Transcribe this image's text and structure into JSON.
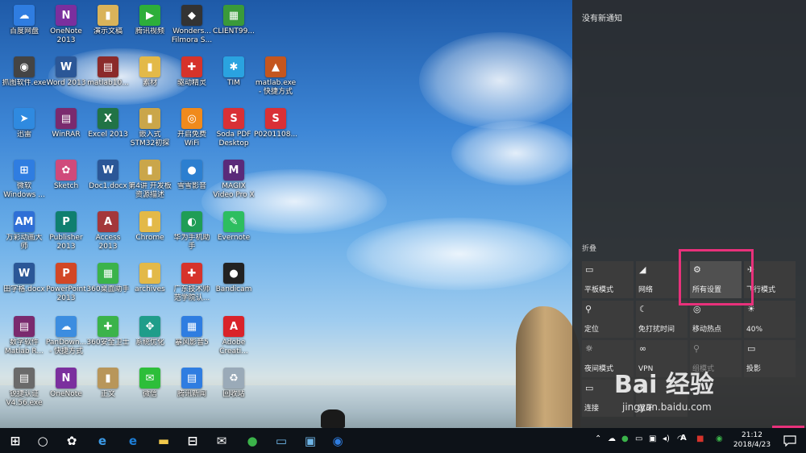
{
  "desktop": {
    "icons": [
      {
        "label": "百度网盘",
        "glyph": "☁",
        "color": "#2f7de1"
      },
      {
        "label": "OneNote\n2013",
        "glyph": "N",
        "color": "#7b2f9e"
      },
      {
        "label": "演示文稿",
        "glyph": "▮",
        "color": "#d9b35a"
      },
      {
        "label": "腾讯视频",
        "glyph": "▶",
        "color": "#2dae3a"
      },
      {
        "label": "Wonders...\nFilmora S...",
        "glyph": "◆",
        "color": "#333333"
      },
      {
        "label": "CLIENT99...",
        "glyph": "▦",
        "color": "#3a9a3a"
      },
      {
        "label": "抓图软件.exe",
        "glyph": "◉",
        "color": "#444444"
      },
      {
        "label": "Word 2013",
        "glyph": "W",
        "color": "#2b5797"
      },
      {
        "label": "matlab10...",
        "glyph": "▤",
        "color": "#8b2a2a"
      },
      {
        "label": "素材",
        "glyph": "▮",
        "color": "#e3b948"
      },
      {
        "label": "驱动精灵",
        "glyph": "✚",
        "color": "#d6332b"
      },
      {
        "label": "TIM",
        "glyph": "✱",
        "color": "#2aa3e0"
      },
      {
        "label": "matlab.exe\n- 快捷方式",
        "glyph": "▲",
        "color": "#c4561f"
      },
      {
        "label": "迅雷",
        "glyph": "➤",
        "color": "#2f8ae0"
      },
      {
        "label": "WinRAR",
        "glyph": "▤",
        "color": "#7a2a6e"
      },
      {
        "label": "Excel 2013",
        "glyph": "X",
        "color": "#217346"
      },
      {
        "label": "嵌入式\nSTM32初探",
        "glyph": "▮",
        "color": "#caa64a"
      },
      {
        "label": "开启免费\nWiFi",
        "glyph": "◎",
        "color": "#f08a1c"
      },
      {
        "label": "Soda PDF\nDesktop",
        "glyph": "S",
        "color": "#d93036"
      },
      {
        "label": "P0201108...",
        "glyph": "S",
        "color": "#d93036"
      },
      {
        "label": "微软\nWindows ...",
        "glyph": "⊞",
        "color": "#2f7de1"
      },
      {
        "label": "Sketch",
        "glyph": "✿",
        "color": "#d04a7b"
      },
      {
        "label": "Doc1.docx",
        "glyph": "W",
        "color": "#2b5797"
      },
      {
        "label": "第4讲 开发板\n资源描述",
        "glyph": "▮",
        "color": "#caa64a"
      },
      {
        "label": "雪雪影音",
        "glyph": "●",
        "color": "#2c7fd0"
      },
      {
        "label": "MAGIX\nVideo Pro X",
        "glyph": "M",
        "color": "#5a2a7a"
      },
      {
        "label": "万彩动画大\n师",
        "glyph": "AM",
        "color": "#2f6fd6"
      },
      {
        "label": "Publisher\n2013",
        "glyph": "P",
        "color": "#0f7f6f"
      },
      {
        "label": "Access 2013",
        "glyph": "A",
        "color": "#a4373a"
      },
      {
        "label": "Chrome",
        "glyph": "▮",
        "color": "#e3b948"
      },
      {
        "label": "华为手机助\n手",
        "glyph": "◐",
        "color": "#1f9d55"
      },
      {
        "label": "Evernote",
        "glyph": "✎",
        "color": "#2dbe60"
      },
      {
        "label": "田字格.docx",
        "glyph": "W",
        "color": "#2b5797"
      },
      {
        "label": "PowerPoint\n2013",
        "glyph": "P",
        "color": "#d24726"
      },
      {
        "label": "360桌面助手",
        "glyph": "▦",
        "color": "#3bb34a"
      },
      {
        "label": "archives",
        "glyph": "▮",
        "color": "#e3b948"
      },
      {
        "label": "广东技术师\n范学院认...",
        "glyph": "✚",
        "color": "#d6332b"
      },
      {
        "label": "Bandicam",
        "glyph": "●",
        "color": "#222222"
      },
      {
        "label": "数字软件\nMatlab R...",
        "glyph": "▤",
        "color": "#7a2a6e"
      },
      {
        "label": "PanDown...\n- 快捷方式",
        "glyph": "☁",
        "color": "#3c8de0"
      },
      {
        "label": "360安全卫士",
        "glyph": "✚",
        "color": "#3bb34a"
      },
      {
        "label": "系统优化",
        "glyph": "✥",
        "color": "#1f9d8a"
      },
      {
        "label": "暴风影音5",
        "glyph": "▦",
        "color": "#2f7de1"
      },
      {
        "label": "Adobe\nCreati...",
        "glyph": "A",
        "color": "#d9232a"
      },
      {
        "label": "锐捷认证\nV4.56.exe",
        "glyph": "▤",
        "color": "#6a6a6a"
      },
      {
        "label": "OneNote",
        "glyph": "N",
        "color": "#7b2f9e"
      },
      {
        "label": "正文",
        "glyph": "▮",
        "color": "#b8965a"
      },
      {
        "label": "微信",
        "glyph": "✉",
        "color": "#2dbe3a"
      },
      {
        "label": "腾讯新闻",
        "glyph": "▤",
        "color": "#2f7de1"
      },
      {
        "label": "回收站",
        "glyph": "♻",
        "color": "#9aaab8"
      }
    ]
  },
  "action_center": {
    "no_notifications": "没有新通知",
    "collapse_label": "折叠",
    "tiles": [
      {
        "label": "平板模式",
        "icon": "▭",
        "state": "off"
      },
      {
        "label": "网络",
        "icon": "◢",
        "state": "off"
      },
      {
        "label": "所有设置",
        "icon": "⚙",
        "state": "on"
      },
      {
        "label": "飞行模式",
        "icon": "✈",
        "state": "off"
      },
      {
        "label": "定位",
        "icon": "⚲",
        "state": "off"
      },
      {
        "label": "免打扰时间",
        "icon": "☾",
        "state": "off"
      },
      {
        "label": "移动热点",
        "icon": "◎",
        "state": "off"
      },
      {
        "label": "40%",
        "icon": "☀",
        "state": "off"
      },
      {
        "label": "夜间模式",
        "icon": "☼",
        "state": "off"
      },
      {
        "label": "VPN",
        "icon": "∞",
        "state": "off"
      },
      {
        "label": "组模式",
        "icon": "⚲",
        "state": "dim"
      },
      {
        "label": "投影",
        "icon": "▭",
        "state": "off"
      },
      {
        "label": "连接",
        "icon": "▭",
        "state": "off"
      },
      {
        "label": "蓝牙",
        "icon": "ᛒ",
        "state": "off"
      }
    ]
  },
  "watermark": {
    "main": "Bai 经验",
    "url": "jingyan.baidu.com"
  },
  "taskbar": {
    "buttons": [
      {
        "name": "start-button",
        "icon": "windows-icon",
        "color": "#ffffff"
      },
      {
        "name": "cortana-button",
        "icon": "circle-icon",
        "color": "#ffffff"
      },
      {
        "name": "taskbar-app-1",
        "icon": "flower-icon",
        "color": "#ffffff"
      },
      {
        "name": "taskbar-ie",
        "icon": "ie-icon",
        "color": "#3c9be8"
      },
      {
        "name": "taskbar-edge",
        "icon": "edge-icon",
        "color": "#1d7fd8"
      },
      {
        "name": "taskbar-explorer",
        "icon": "folder-icon",
        "color": "#f2c94c"
      },
      {
        "name": "taskbar-store",
        "icon": "store-icon",
        "color": "#ffffff"
      },
      {
        "name": "taskbar-mail",
        "icon": "mail-icon",
        "color": "#ffffff"
      },
      {
        "name": "taskbar-app-green",
        "icon": "green-circle-icon",
        "color": "#3bb34a"
      },
      {
        "name": "taskbar-app-pc",
        "icon": "pc-icon",
        "color": "#6fb6e8"
      },
      {
        "name": "taskbar-app-window",
        "icon": "window-icon",
        "color": "#6fb6e8"
      },
      {
        "name": "taskbar-app-blue",
        "icon": "blue-circle-icon",
        "color": "#2f7de1"
      }
    ],
    "tray_input": "A",
    "clock_time": "21:12",
    "clock_date": "2018/4/23"
  }
}
